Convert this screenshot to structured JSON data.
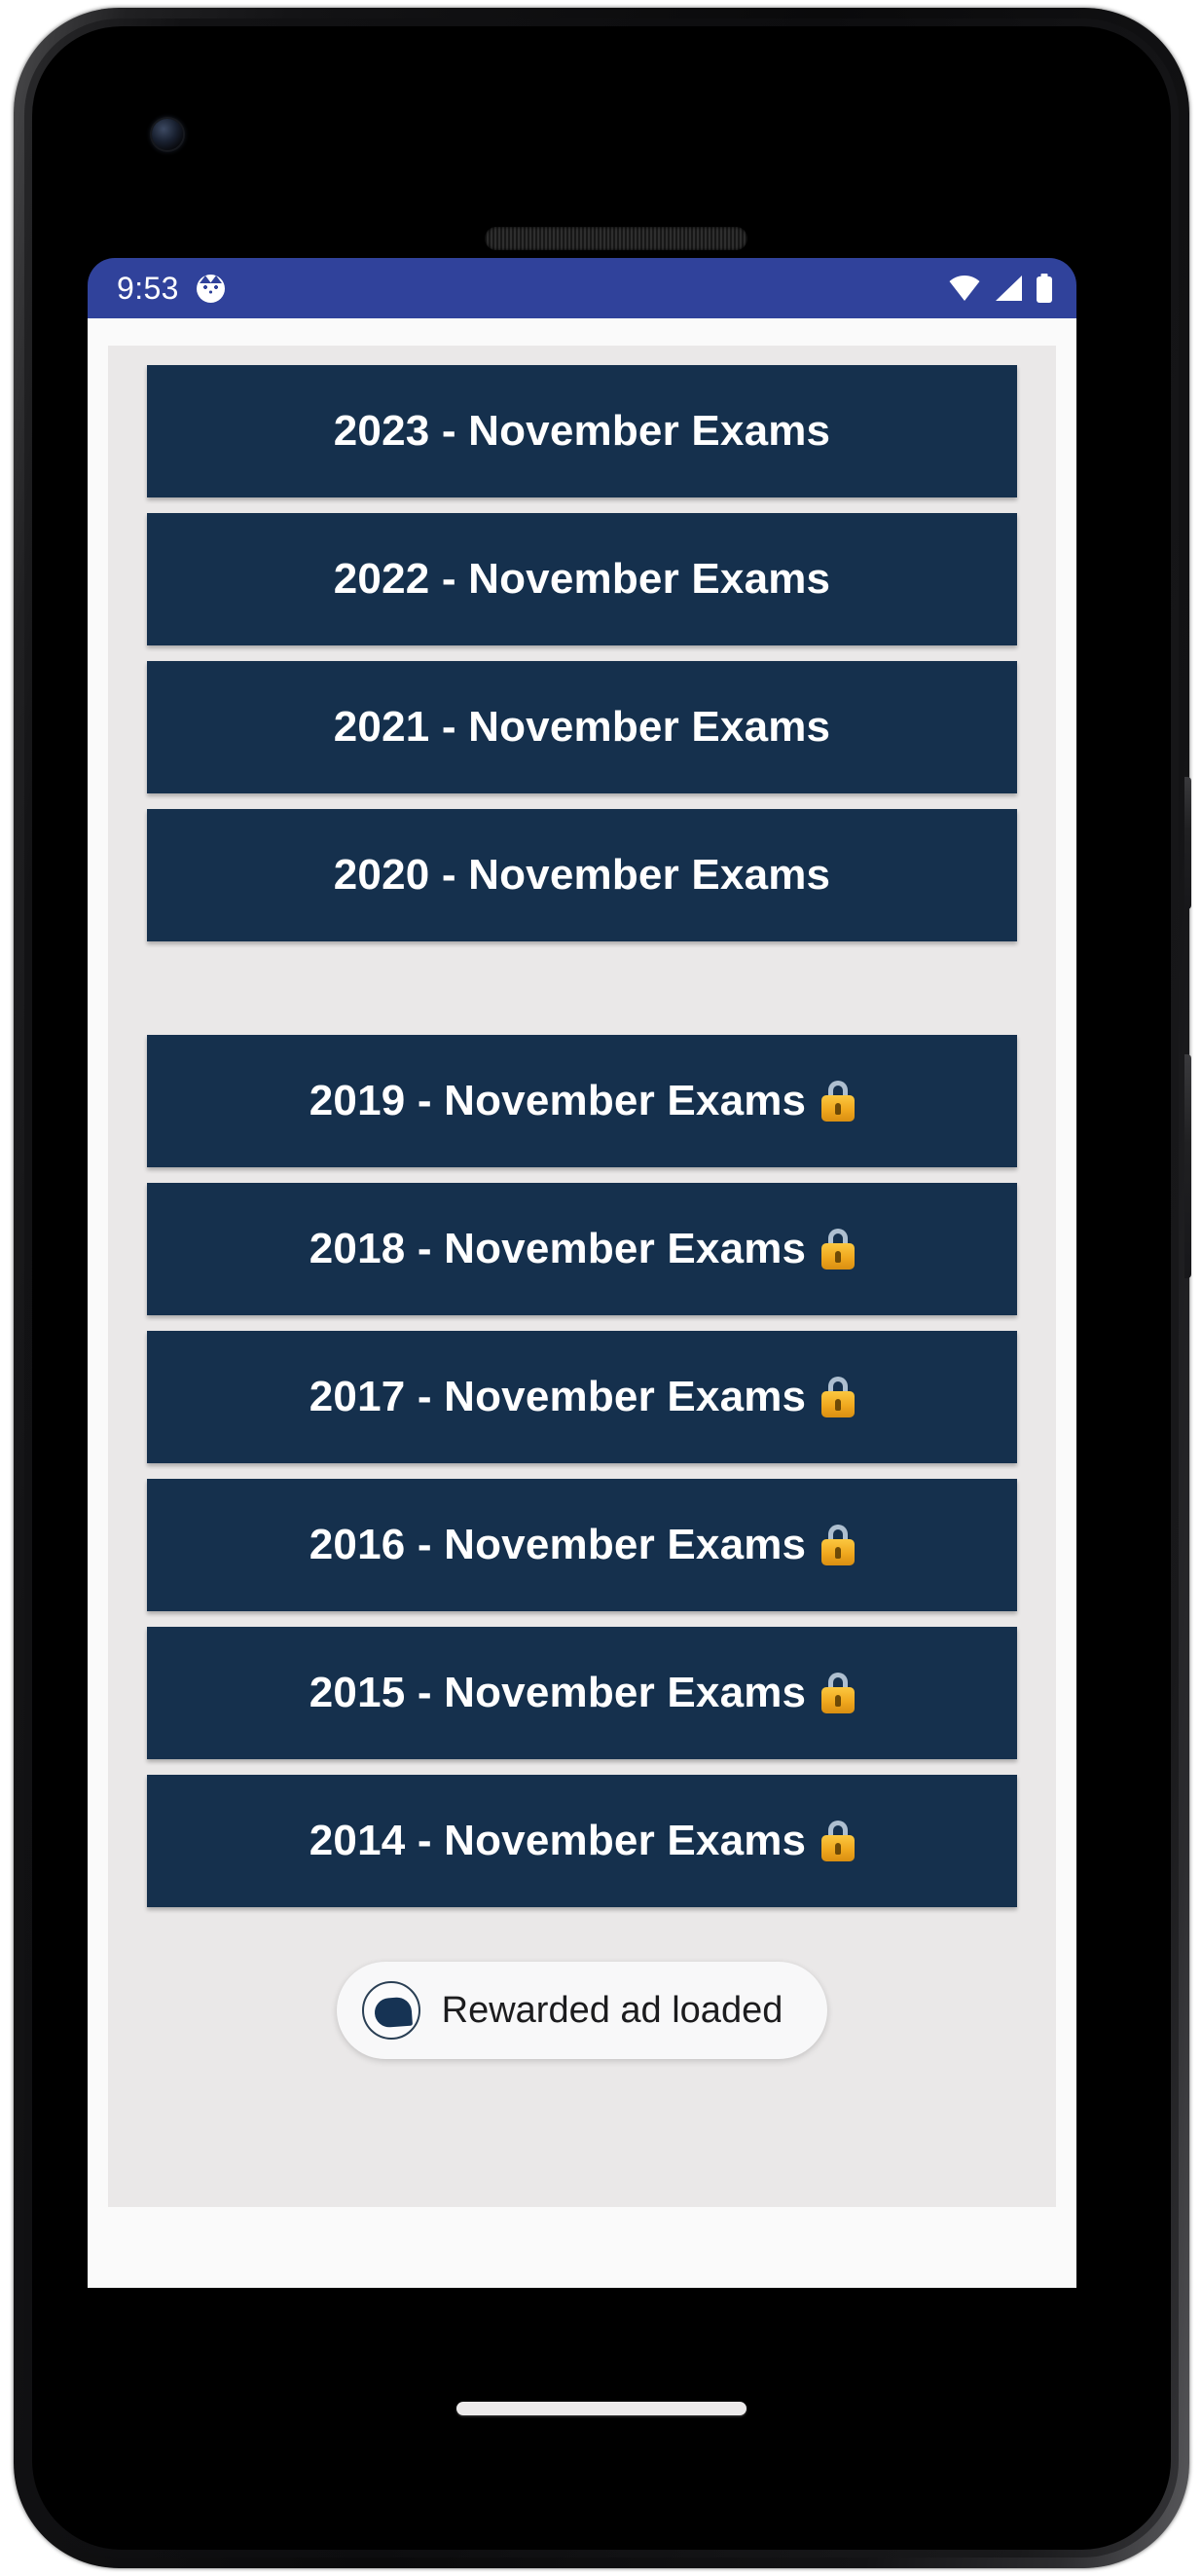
{
  "status_bar": {
    "time": "9:53",
    "notification_icon": "cat-avatar-icon",
    "wifi_icon": "wifi-icon",
    "signal_icon": "cellular-signal-icon",
    "battery_icon": "battery-full-icon",
    "background_color": "#30429b",
    "foreground_color": "#ffffff"
  },
  "theme": {
    "button_color": "#15304d",
    "button_text_color": "#ffffff",
    "panel_background": "#eae8e8",
    "app_background": "#fafafa"
  },
  "main": {
    "unlocked_exams": [
      {
        "label": "2023 - November Exams",
        "locked": false
      },
      {
        "label": "2022 - November Exams",
        "locked": false
      },
      {
        "label": "2021 - November Exams",
        "locked": false
      },
      {
        "label": "2020 - November Exams",
        "locked": false
      }
    ],
    "locked_exams": [
      {
        "label": "2019 - November Exams",
        "locked": true,
        "lock_icon": "lock-icon"
      },
      {
        "label": "2018 - November Exams",
        "locked": true,
        "lock_icon": "lock-icon"
      },
      {
        "label": "2017 - November Exams",
        "locked": true,
        "lock_icon": "lock-icon"
      },
      {
        "label": "2016 - November Exams",
        "locked": true,
        "lock_icon": "lock-icon"
      },
      {
        "label": "2015 - November Exams",
        "locked": true,
        "lock_icon": "lock-icon"
      },
      {
        "label": "2014 - November Exams",
        "locked": true,
        "lock_icon": "lock-icon"
      }
    ]
  },
  "toast": {
    "text": "Rewarded ad loaded",
    "icon": "app-logo-icon"
  },
  "device": {
    "camera_icon": "front-camera-icon",
    "earpiece_icon": "earpiece-speaker-icon",
    "power_button": "power-button",
    "volume_button": "volume-rocker-button",
    "gesture_bar": "home-gesture-bar"
  }
}
